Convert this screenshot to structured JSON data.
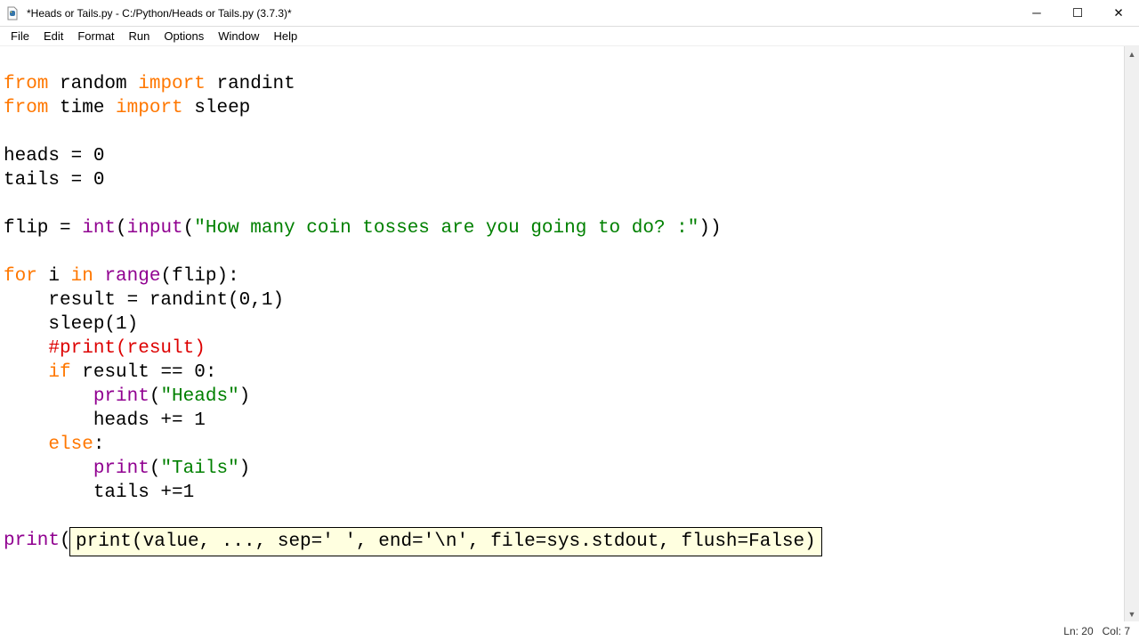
{
  "window": {
    "title": "*Heads or Tails.py - C:/Python/Heads or Tails.py (3.7.3)*"
  },
  "menu": {
    "items": [
      "File",
      "Edit",
      "Format",
      "Run",
      "Options",
      "Window",
      "Help"
    ]
  },
  "code": {
    "l1a": "from",
    "l1b": " random ",
    "l1c": "import",
    "l1d": " randint",
    "l2a": "from",
    "l2b": " time ",
    "l2c": "import",
    "l2d": " sleep",
    "l3": "",
    "l4": "heads = 0",
    "l5": "tails = 0",
    "l6": "",
    "l7a": "flip = ",
    "l7b": "int",
    "l7c": "(",
    "l7d": "input",
    "l7e": "(",
    "l7f": "\"How many coin tosses are you going to do? :\"",
    "l7g": "))",
    "l8": "",
    "l9a": "for",
    "l9b": " i ",
    "l9c": "in",
    "l9d": " ",
    "l9e": "range",
    "l9f": "(flip):",
    "l10": "    result = randint(0,1)",
    "l11": "    sleep(1)",
    "l12": "    #print(result)",
    "l13a": "    ",
    "l13b": "if",
    "l13c": " result == 0:",
    "l14a": "        ",
    "l14b": "print",
    "l14c": "(",
    "l14d": "\"Heads\"",
    "l14e": ")",
    "l15": "        heads += 1",
    "l16a": "    ",
    "l16b": "else",
    "l16c": ":",
    "l17a": "        ",
    "l17b": "print",
    "l17c": "(",
    "l17d": "\"Tails\"",
    "l17e": ")",
    "l18": "        tails +=1",
    "l19": "",
    "l20a": "print",
    "l20b": "(",
    "l20c": "\""
  },
  "calltip": {
    "text": "print(value, ..., sep=' ', end='\\n', file=sys.stdout, flush=False)"
  },
  "status": {
    "ln": "Ln: 20",
    "col": "Col: 7"
  },
  "icons": {
    "minimize": "─",
    "maximize": "☐",
    "close": "✕",
    "up": "▲",
    "down": "▼"
  }
}
